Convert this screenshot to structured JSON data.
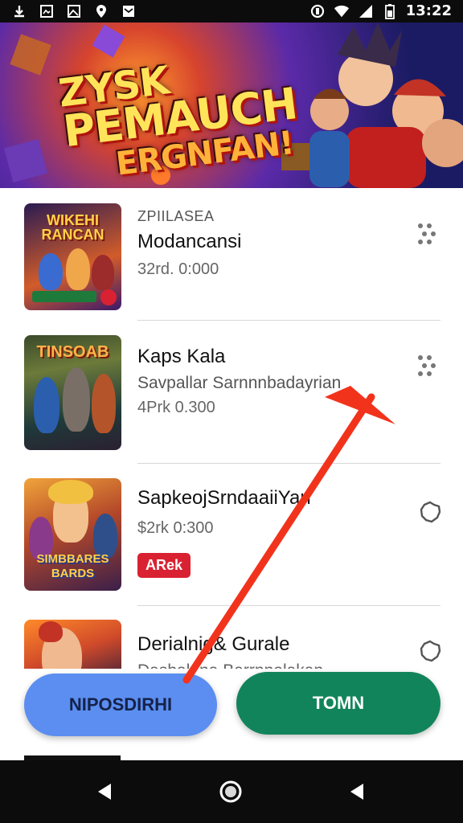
{
  "status": {
    "time": "13:22",
    "icons": [
      "download-icon",
      "gallery-icon",
      "image-icon",
      "location-icon",
      "mail-icon"
    ],
    "right_icons": [
      "vibrate-icon",
      "wifi-icon",
      "signal-icon",
      "battery-icon"
    ]
  },
  "banner": {
    "line1": "ZYSK",
    "line2": "PEMAUCH",
    "line3": "ERGNFAN!"
  },
  "items": [
    {
      "thumb_text": "WIKEHI RANCAN",
      "kicker": "ZPIILASEA",
      "title": "Modancansi",
      "meta": "32rd. 0:000"
    },
    {
      "thumb_text": "TINSOAB",
      "title": "Kaps Kala",
      "subtitle": "Savpallar Sarnnnbadayrian",
      "meta": "4Prk 0.300"
    },
    {
      "thumb_text": "SIMBBARES BARDS",
      "title": "SapkeojSrndaaiiYan",
      "meta": "$2rk 0:300",
      "badge": "ARek"
    },
    {
      "title": "Derialnig& Gurale",
      "subtitle": "Dasbaluna Barrnnelakan"
    }
  ],
  "buttons": {
    "left": "NIPOSDIRHI",
    "right": "TOMN"
  },
  "colors": {
    "left_button": "#5b8ef0",
    "right_button": "#12845c",
    "badge": "#d92231",
    "arrow": "#f2331c"
  }
}
